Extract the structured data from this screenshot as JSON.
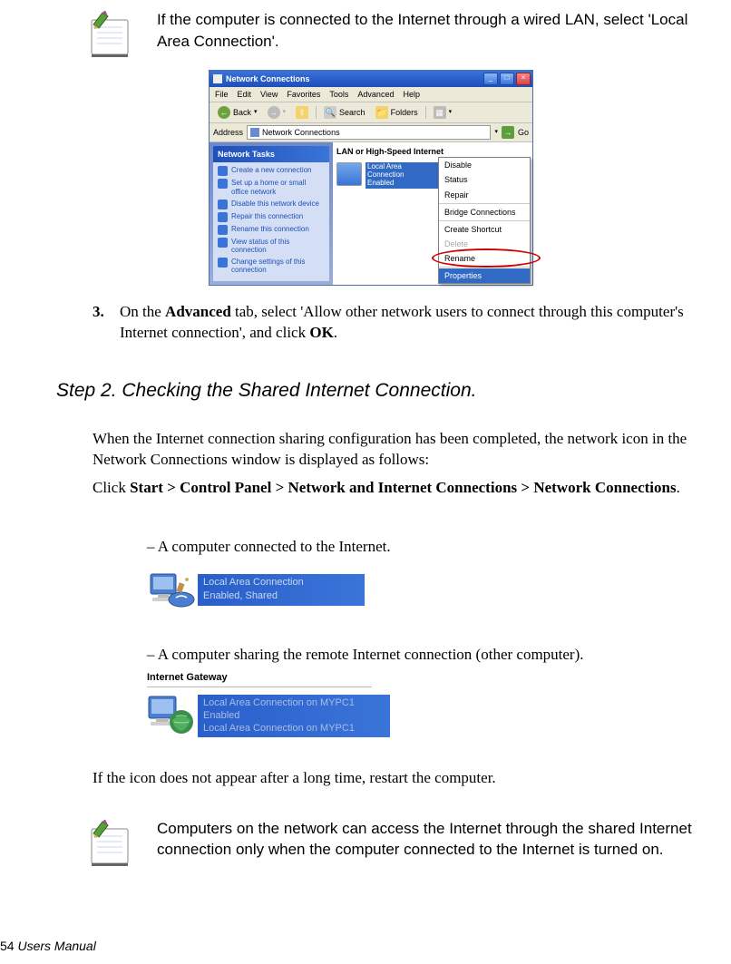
{
  "notes": {
    "note1": "If the computer is connected to the Internet through a wired LAN, select 'Local Area Connection'.",
    "note2": "Computers on the network can access the Internet through the shared Internet connection only when the computer connected to the Internet is turned on."
  },
  "screenshot": {
    "title": "Network Connections",
    "menu": {
      "file": "File",
      "edit": "Edit",
      "view": "View",
      "favorites": "Favorites",
      "tools": "Tools",
      "advanced": "Advanced",
      "help": "Help"
    },
    "toolbar": {
      "back": "Back",
      "search": "Search",
      "folders": "Folders"
    },
    "address_label": "Address",
    "address_value": "Network Connections",
    "go": "Go",
    "side_header": "Network Tasks",
    "side_items": [
      "Create a new connection",
      "Set up a home or small office network",
      "Disable this network device",
      "Repair this connection",
      "Rename this connection",
      "View status of this connection",
      "Change settings of this connection"
    ],
    "category": "LAN or High-Speed Internet",
    "conn_name": "Local Area Connection",
    "conn_status": "Enabled",
    "context_menu": {
      "disable": "Disable",
      "status": "Status",
      "repair": "Repair",
      "bridge": "Bridge Connections",
      "shortcut": "Create Shortcut",
      "delete": "Delete",
      "rename": "Rename",
      "properties": "Properties"
    }
  },
  "step3": {
    "num": "3.",
    "text_pre": "On the ",
    "advanced": "Advanced",
    "text_mid": " tab, select 'Allow other network users to connect through this computer's Internet connection', and click ",
    "ok": "OK",
    "text_post": "."
  },
  "step_title": "Step 2. Checking the Shared Internet Connection.",
  "para1": "When the Internet connection sharing configuration has been completed, the network icon in the Network Connections window is displayed as follows:",
  "para2_pre": "Click ",
  "para2_bold": "Start > Control Panel > Network and Internet Connections > Network Connections",
  "para2_post": ".",
  "sub1": "– A computer connected to the Internet.",
  "lac1_line1": "Local Area Connection",
  "lac1_line2": "Enabled, Shared",
  "sub2": "– A computer sharing the remote Internet connection (other computer).",
  "ig_label": "Internet Gateway",
  "lac2_line1": "Local Area Connection on MYPC1",
  "lac2_line2": "Enabled",
  "lac2_line3": "Local Area Connection on MYPC1",
  "para3": "If the icon does not appear after a long time, restart the computer.",
  "footer_num": "54",
  "footer_text": "  Users Manual"
}
